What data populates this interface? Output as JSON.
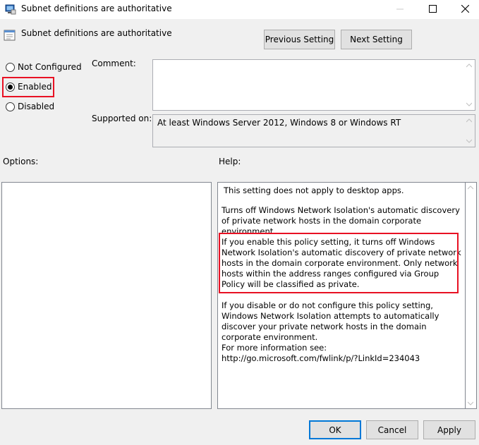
{
  "window": {
    "title": "Subnet definitions are authoritative",
    "minimize_glyph": "—",
    "maximize_glyph": "☐",
    "close_glyph": "✕"
  },
  "header": {
    "policy_name": "Subnet definitions are authoritative",
    "prev_label": "Previous Setting",
    "next_label": "Next Setting"
  },
  "state": {
    "options": [
      {
        "label": "Not Configured",
        "selected": false
      },
      {
        "label": "Enabled",
        "selected": true
      },
      {
        "label": "Disabled",
        "selected": false
      }
    ]
  },
  "comment": {
    "label": "Comment:",
    "value": ""
  },
  "supported": {
    "label": "Supported on:",
    "value": "At least Windows Server 2012, Windows 8 or Windows RT"
  },
  "options_pane": {
    "label": "Options:"
  },
  "help_pane": {
    "label": "Help:",
    "paragraphs": [
      "This setting does not apply to desktop apps.",
      "Turns off  Windows Network Isolation's automatic discovery of private network hosts in the domain corporate environment.",
      "If you enable this policy setting, it turns off Windows Network Isolation's automatic discovery of private network hosts in the domain corporate environment. Only network hosts within the address ranges configured via Group Policy will be classified as private.",
      "If you disable or do not configure this policy setting, Windows Network Isolation attempts to automatically discover your private network hosts in the domain corporate environment.",
      "For more information see: http://go.microsoft.com/fwlink/p/?LinkId=234043"
    ]
  },
  "footer": {
    "ok_label": "OK",
    "cancel_label": "Cancel",
    "apply_label": "Apply"
  },
  "icons": {
    "title": "policy-computer-icon",
    "policy": "policy-setting-icon"
  },
  "colors": {
    "highlight": "#e81123",
    "ok_border": "#0078d7"
  }
}
